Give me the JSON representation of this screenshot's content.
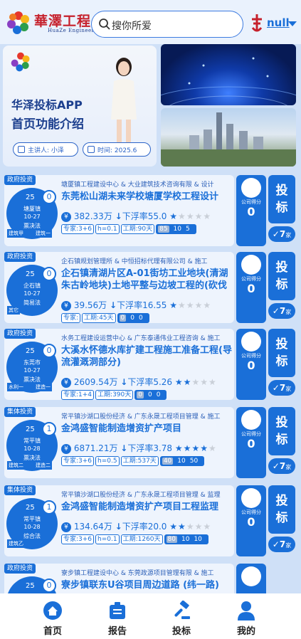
{
  "header": {
    "brand_cn": "華澤工程",
    "brand_en": "HuaZe Engineering",
    "search_placeholder": "搜你所爱",
    "city": "null"
  },
  "banner": {
    "title1": "华泽投标APP",
    "title2": "首页功能介绍",
    "host": "主讲人: 小泽",
    "time": "时间: 2025.6"
  },
  "labels": {
    "score_label": "公司得分",
    "bid_button": "投标",
    "bid_suffix": "家"
  },
  "cards": [
    {
      "category": "政府投资",
      "dial_num": "25",
      "badge": "0",
      "city": "塘厦镇",
      "date": "10-27",
      "mode": "票决法",
      "foot_l": "建筑甲",
      "foot_r": "建筑一",
      "units": "塘厦镇工程建设中心 & 大业建筑技术咨询有限 & 设计",
      "title": "东莞松山湖未来学校塘厦学校工程设计",
      "price": "382.33万",
      "down_rate": "下浮率55.0",
      "stars": 1,
      "tags": [
        "专家:3+6",
        "h=0.1",
        "工期:90天"
      ],
      "bar": [
        "85",
        "10",
        "5"
      ],
      "score": "0",
      "bidders": "7"
    },
    {
      "category": "政府投资",
      "dial_num": "25",
      "badge": "0",
      "city": "企石镇",
      "date": "10-27",
      "mode": "简易法",
      "foot_l": "其它",
      "foot_r": "",
      "units": "企石镇规划管理所 & 中恒招标代理有限公司 & 施工",
      "title": "企石镇清湖片区A-01街坊工业地块(清湖朱古岭地块)土地平整与边坡工程的(砍伐",
      "price": "39.56万",
      "down_rate": "下浮率16.55",
      "stars": 1,
      "tags": [
        "专家:",
        "工期:45天"
      ],
      "bar": [
        "0",
        "0",
        "0"
      ],
      "score": "0",
      "bidders": "7"
    },
    {
      "category": "政府投资",
      "dial_num": "25",
      "badge": "0",
      "city": "东莞市",
      "date": "10-27",
      "mode": "票决法",
      "foot_l": "水利一",
      "foot_r": "建造一",
      "units": "水务工程建设运营中心 & 广东泰通伟业工程咨询 & 施工",
      "title": "大溪水怀德水库扩建工程施工准备工程(导流灌溉洞部分)",
      "price": "2609.54万",
      "down_rate": "下浮率5.26",
      "stars": 2,
      "tags": [
        "专家:1+4",
        "工期:390天"
      ],
      "bar": [
        "0",
        "0",
        "0"
      ],
      "score": "0",
      "bidders": "7"
    },
    {
      "category": "集体投资",
      "dial_num": "25",
      "badge": "1",
      "city": "常平镇",
      "date": "10-28",
      "mode": "票决法",
      "foot_l": "建筑二",
      "foot_r": "建造二",
      "units": "常平镇沙湖口股份经济 & 广东永晟工程项目管理 & 施工",
      "title": "金鸿盛智能制造增资扩产项目",
      "price": "6871.21万",
      "down_rate": "下浮率3.78",
      "stars": 4,
      "tags": [
        "专家:3+6",
        "h=0.5",
        "工期:537天"
      ],
      "bar": [
        "40",
        "10",
        "50"
      ],
      "score": "0",
      "bidders": "7"
    },
    {
      "category": "集体投资",
      "dial_num": "25",
      "badge": "1",
      "city": "常平镇",
      "date": "10-28",
      "mode": "综合法",
      "foot_l": "建筑乙",
      "foot_r": "",
      "units": "常平镇沙湖口股份经济 & 广东永晟工程项目管理 & 监理",
      "title": "金鸿盛智能制造增资扩产项目工程监理",
      "price": "134.64万",
      "down_rate": "下浮率20.0",
      "stars": 2,
      "tags": [
        "专家:3+6",
        "h=0.1",
        "工期:1260天"
      ],
      "bar": [
        "80",
        "10",
        "10"
      ],
      "score": "0",
      "bidders": "7"
    },
    {
      "category": "政府投资",
      "dial_num": "25",
      "badge": "0",
      "city": "",
      "date": "",
      "mode": "",
      "foot_l": "",
      "foot_r": "",
      "units": "寮步镇工程建设中心 & 东莞政源项目管理有限 & 施工",
      "title": "寮步镇联东U谷项目周边道路 (纬一路)",
      "price": "",
      "down_rate": "",
      "stars": 0,
      "tags": [],
      "bar": [],
      "score": "",
      "bidders": ""
    }
  ],
  "nav": [
    {
      "label": "首页",
      "icon": "home-icon"
    },
    {
      "label": "报告",
      "icon": "report-icon"
    },
    {
      "label": "投标",
      "icon": "gavel-icon"
    },
    {
      "label": "我的",
      "icon": "user-icon"
    }
  ],
  "colors": {
    "accent": "#1a6fd8",
    "brand_red": "#c6212c",
    "page_bg": "#cfe0f7"
  }
}
